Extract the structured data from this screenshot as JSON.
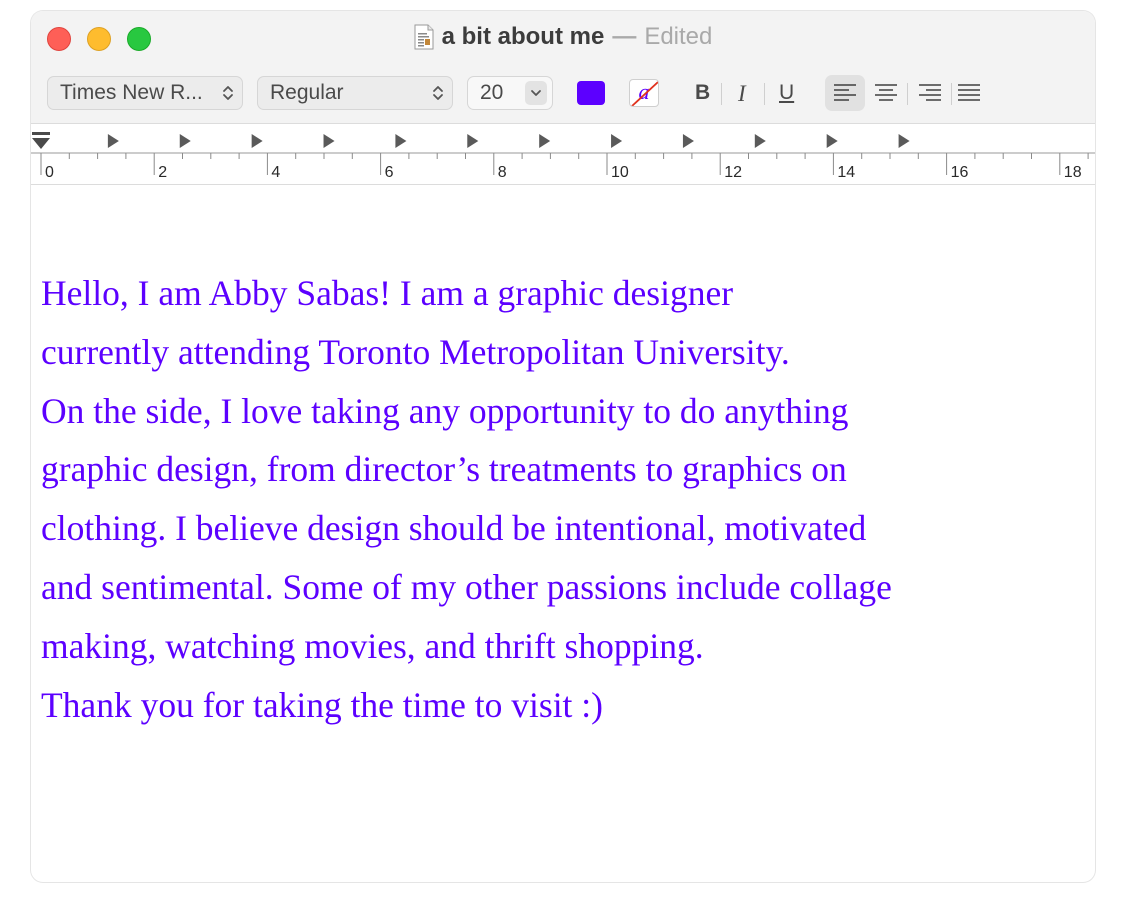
{
  "window": {
    "title": "a bit about me",
    "title_separator": "—",
    "status": "Edited"
  },
  "toolbar": {
    "font_family": "Times New R...",
    "font_style": "Regular",
    "font_size": "20",
    "text_color": "#5c00ff",
    "bold_label": "B",
    "italic_label": "I",
    "underline_label": "U",
    "bg_color_glyph": "a",
    "alignment_selected": "left"
  },
  "ruler": {
    "numbers": [
      "0",
      "2",
      "4",
      "6",
      "8",
      "10",
      "12",
      "14",
      "16",
      "18"
    ]
  },
  "document": {
    "text_color": "#5c00ff",
    "lines": [
      "Hello, I am Abby Sabas! I am a graphic designer",
      "currently attending Toronto Metropolitan University.",
      "On the side, I love taking any opportunity to do anything",
      "graphic design, from director’s treatments to graphics on",
      "clothing. I believe design should be intentional, motivated",
      "and sentimental. Some of my other passions include collage",
      "making, watching movies, and thrift shopping.",
      "Thank you for taking the time to visit :)"
    ]
  }
}
